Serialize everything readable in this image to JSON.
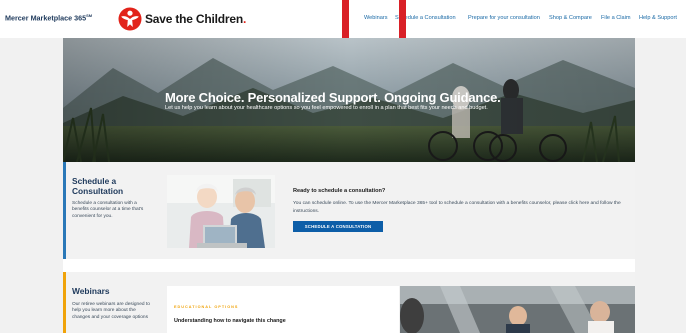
{
  "header": {
    "mercer_brand": "Mercer Marketplace 365",
    "mercer_mark": "SM",
    "partner_name": "Save the Children",
    "partner_mark": "."
  },
  "nav": {
    "items": [
      {
        "label": "Webinars"
      },
      {
        "label": "Schedule a Consultation"
      },
      {
        "label": "Prepare for your consultation"
      },
      {
        "label": "Shop & Compare"
      },
      {
        "label": "File a Claim"
      },
      {
        "label": "Help & Support"
      }
    ]
  },
  "hero": {
    "title": "More Choice. Personalized Support. Ongoing Guidance.",
    "subtitle": "Let us help you learn about your healthcare options so you feel empowered to enroll in a plan that best fits your needs and budget."
  },
  "schedule": {
    "title": "Schedule a Consultation",
    "description": "Schedule a consultation with a benefits counselor at a time that's convenient for you.",
    "question": "Ready to schedule a consultation?",
    "body": "You can schedule online. To use the Mercer Marketplace 365+ tool to schedule a consultation with a benefits counselor, please click here and follow the instructions.",
    "button_label": "SCHEDULE A CONSULTATION"
  },
  "webinars": {
    "title": "Webinars",
    "description": "Our retiree webinars are designed to help you learn more about the changes and your coverage options",
    "kicker": "EDUCATIONAL OPTIONS",
    "heading": "Understanding how to navigate this change"
  },
  "colors": {
    "accent_blue": "#0d5ea8",
    "nav_link": "#1a6aa6",
    "highlight": "#d92027",
    "webinar_accent": "#f0a30a"
  }
}
